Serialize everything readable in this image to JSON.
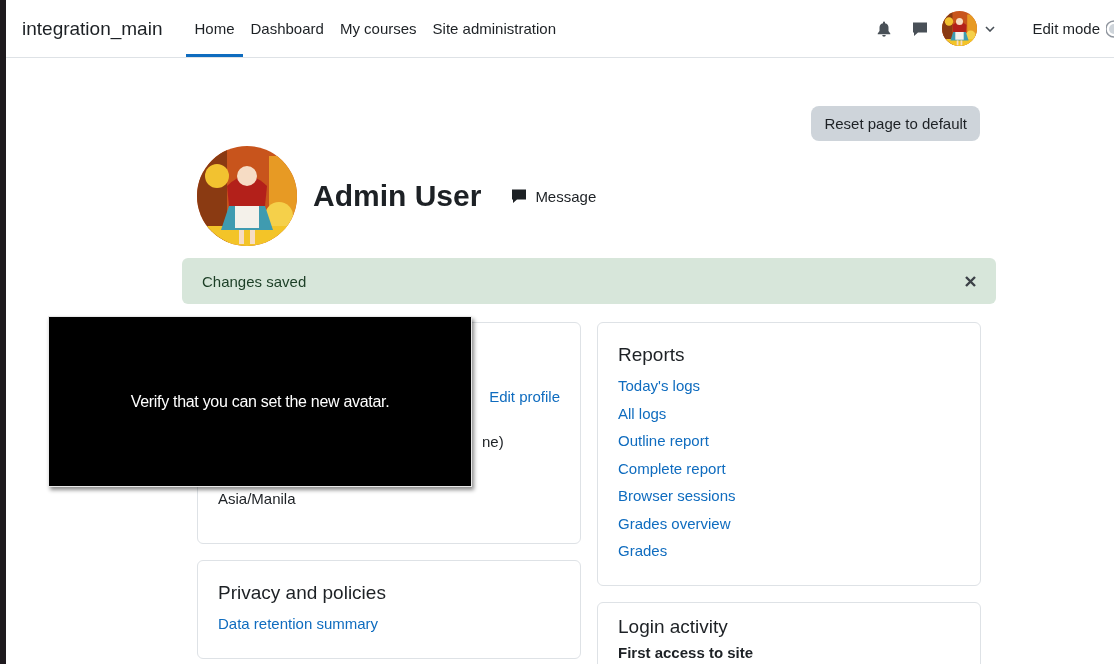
{
  "navbar": {
    "site_name": "integration_main",
    "nav": [
      {
        "label": "Home",
        "selected": true
      },
      {
        "label": "Dashboard",
        "selected": false
      },
      {
        "label": "My courses",
        "selected": false
      },
      {
        "label": "Site administration",
        "selected": false
      }
    ],
    "edit_mode": "Edit mode"
  },
  "profile": {
    "reset_button": "Reset page to default",
    "name": "Admin User",
    "message_button": "Message"
  },
  "alert": {
    "text": "Changes saved"
  },
  "user_details_card": {
    "link": "Edit profile",
    "fragments": [
      "ne)",
      "Asia/Manila"
    ]
  },
  "privacy_card": {
    "title": "Privacy and policies",
    "links": [
      "Data retention summary"
    ]
  },
  "reports_card": {
    "title": "Reports",
    "links": [
      "Today's logs",
      "All logs",
      "Outline report",
      "Complete report",
      "Browser sessions",
      "Grades overview",
      "Grades"
    ]
  },
  "login_activity_card": {
    "title": "Login activity",
    "label": "First access to site"
  },
  "overlay": {
    "text": "Verify that you can set the new avatar."
  }
}
